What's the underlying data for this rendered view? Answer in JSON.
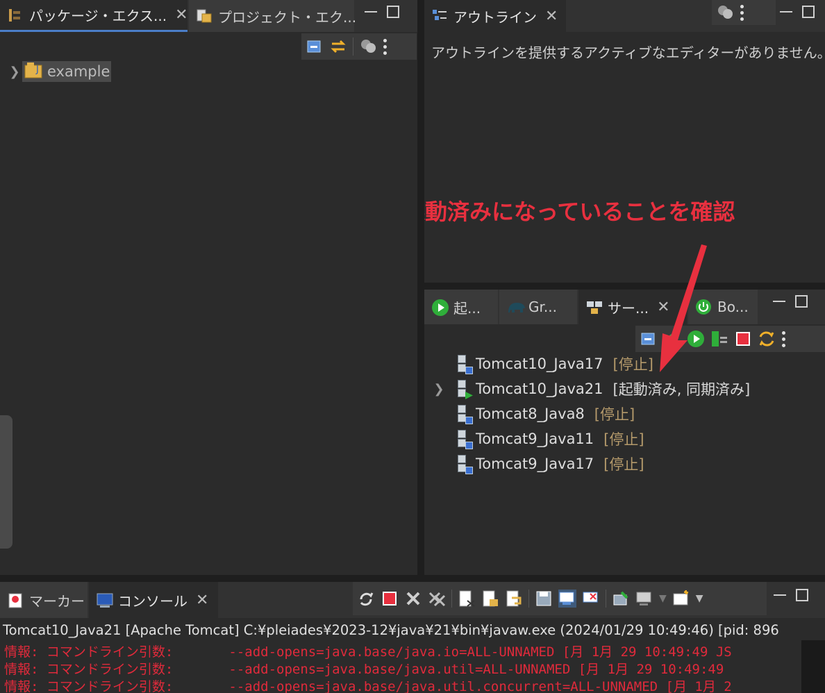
{
  "package_explorer": {
    "tabs": [
      {
        "label": "パッケージ・エクス...",
        "icon": "package-explorer-icon",
        "active": true
      },
      {
        "label": "プロジェクト・エク...",
        "icon": "project-explorer-icon",
        "active": false
      }
    ],
    "tree": [
      {
        "label": "example",
        "icon": "java-project-icon"
      }
    ]
  },
  "outline": {
    "tab_label": "アウトライン",
    "empty_message": "アウトラインを提供するアクティブなエディターがありません。"
  },
  "annotation": {
    "text": "起動済みになっていることを確認",
    "color": "#e8303f"
  },
  "servers_view": {
    "tabs": [
      {
        "label": "起...",
        "icon": "run-icon"
      },
      {
        "label": "Gr...",
        "icon": "gradle-elephant-icon"
      },
      {
        "label": "サー...",
        "icon": "servers-icon",
        "active": true
      },
      {
        "label": "Bo...",
        "icon": "boot-dashboard-icon"
      }
    ],
    "servers": [
      {
        "name": "Tomcat10_Java17",
        "state": "[停止]",
        "expandable": false,
        "running": false
      },
      {
        "name": "Tomcat10_Java21",
        "state": "[起動済み, 同期済み]",
        "expandable": true,
        "running": true
      },
      {
        "name": "Tomcat8_Java8",
        "state": "[停止]",
        "expandable": false,
        "running": false
      },
      {
        "name": "Tomcat9_Java11",
        "state": "[停止]",
        "expandable": false,
        "running": false
      },
      {
        "name": "Tomcat9_Java17",
        "state": "[停止]",
        "expandable": false,
        "running": false
      }
    ]
  },
  "console": {
    "tabs": [
      {
        "label": "マーカー",
        "icon": "markers-icon"
      },
      {
        "label": "コンソール",
        "icon": "console-icon",
        "active": true
      }
    ],
    "header": "Tomcat10_Java21 [Apache Tomcat] C:¥pleiades¥2023-12¥java¥21¥bin¥javaw.exe  (2024/01/29 10:49:46) [pid: 896",
    "lines": [
      "情報: コマンドライン引数:       --add-opens=java.base/java.io=ALL-UNNAMED [月 1月 29 10:49:49 JS",
      "情報: コマンドライン引数:       --add-opens=java.base/java.util=ALL-UNNAMED [月 1月 29 10:49:49 ",
      "情報: コマンドライン引数:       --add-opens=java.base/java.util.concurrent=ALL-UNNAMED [月 1月 2"
    ],
    "error_color": "#e02a3b"
  }
}
